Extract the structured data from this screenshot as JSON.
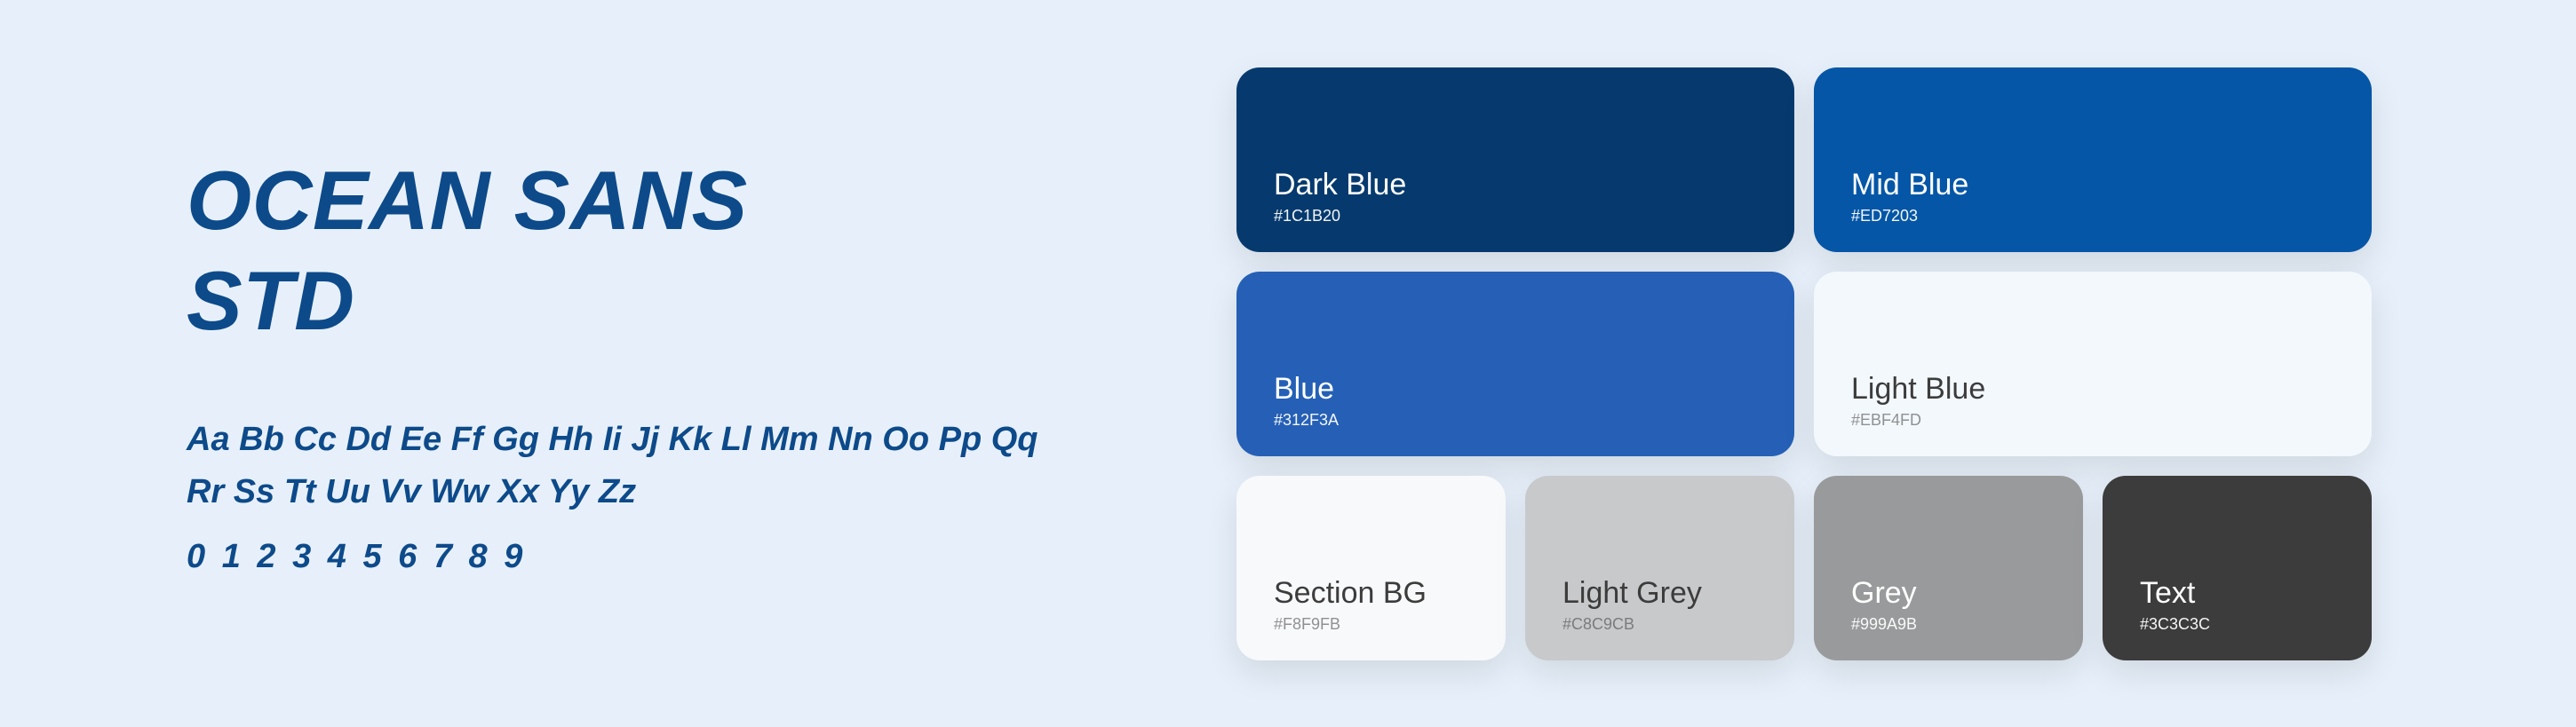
{
  "font": {
    "title": "OCEAN SANS\nSTD",
    "alphabet": "Aa Bb Cc Dd Ee Ff Gg Hh Ii Jj Kk Ll Mm Nn Oo Pp Qq Rr Ss Tt Uu Vv Ww Xx Yy Zz",
    "numbers": "0 1 2 3 4 5 6 7 8 9"
  },
  "swatches": {
    "darkblue": {
      "name": "Dark Blue",
      "hex": "#1C1B20"
    },
    "midblue": {
      "name": "Mid Blue",
      "hex": "#ED7203"
    },
    "blue": {
      "name": "Blue",
      "hex": "#312F3A"
    },
    "lightblue": {
      "name": "Light Blue",
      "hex": "#EBF4FD"
    },
    "sectionbg": {
      "name": "Section BG",
      "hex": "#F8F9FB"
    },
    "lightgrey": {
      "name": "Light Grey",
      "hex": "#C8C9CB"
    },
    "grey": {
      "name": "Grey",
      "hex": "#999A9B"
    },
    "text": {
      "name": "Text",
      "hex": "#3C3C3C"
    }
  }
}
